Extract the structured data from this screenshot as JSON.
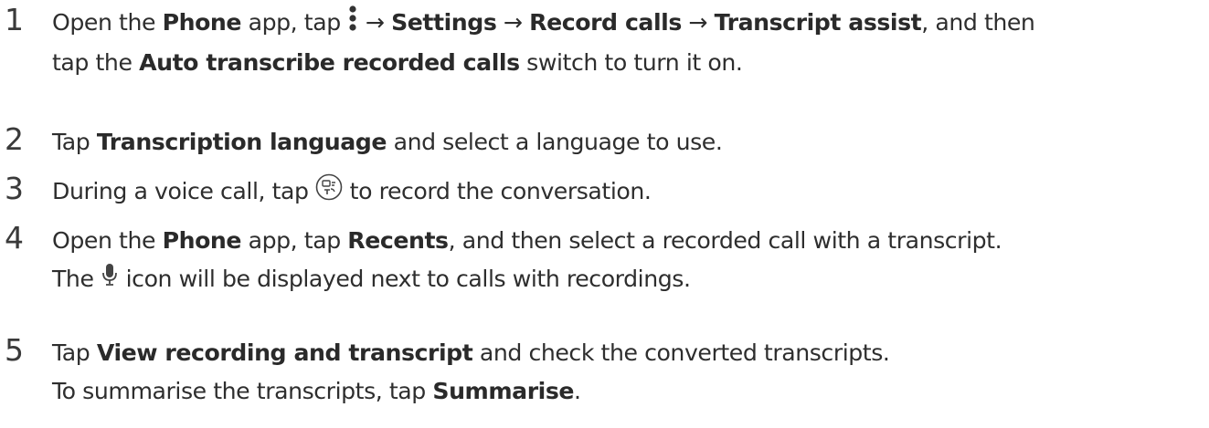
{
  "steps": [
    {
      "number": "1",
      "line1": {
        "t1": "Open the ",
        "b1": "Phone",
        "t2": " app, tap ",
        "more_icon": "more-options-icon",
        "t3": " → ",
        "b2": "Settings",
        "t4": " → ",
        "b3": "Record calls",
        "t5": " → ",
        "b4": "Transcript assist",
        "t6": ", and then"
      },
      "line2": {
        "t1": "tap the ",
        "b1": "Auto transcribe recorded calls",
        "t2": " switch to turn it on."
      }
    },
    {
      "number": "2",
      "line1": {
        "t1": "Tap ",
        "b1": "Transcription language",
        "t2": " and select a language to use."
      }
    },
    {
      "number": "3",
      "line1": {
        "t1": "During a voice call, tap ",
        "record_icon": "call-record-transcript-icon",
        "t2": " to record the conversation."
      }
    },
    {
      "number": "4",
      "line1": {
        "t1": "Open the ",
        "b1": "Phone",
        "t2": " app, tap ",
        "b2": "Recents",
        "t3": ", and then select a recorded call with a transcript."
      },
      "line2": {
        "t1": "The ",
        "mic_icon": "microphone-icon",
        "t2": " icon will be displayed next to calls with recordings."
      }
    },
    {
      "number": "5",
      "line1": {
        "t1": "Tap ",
        "b1": "View recording and transcript",
        "t2": " and check the converted transcripts."
      },
      "line2": {
        "t1": "To summarise the transcripts, tap ",
        "b1": "Summarise",
        "t2": "."
      }
    }
  ]
}
